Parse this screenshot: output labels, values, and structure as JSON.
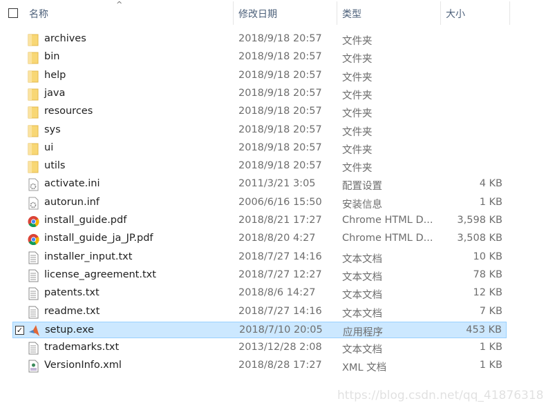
{
  "columns": {
    "name": "名称",
    "modified": "修改日期",
    "type": "类型",
    "size": "大小"
  },
  "files": [
    {
      "name": "archives",
      "modified": "2018/9/18 20:57",
      "type": "文件夹",
      "size": "",
      "icon": "folder"
    },
    {
      "name": "bin",
      "modified": "2018/9/18 20:57",
      "type": "文件夹",
      "size": "",
      "icon": "folder"
    },
    {
      "name": "help",
      "modified": "2018/9/18 20:57",
      "type": "文件夹",
      "size": "",
      "icon": "folder"
    },
    {
      "name": "java",
      "modified": "2018/9/18 20:57",
      "type": "文件夹",
      "size": "",
      "icon": "folder"
    },
    {
      "name": "resources",
      "modified": "2018/9/18 20:57",
      "type": "文件夹",
      "size": "",
      "icon": "folder"
    },
    {
      "name": "sys",
      "modified": "2018/9/18 20:57",
      "type": "文件夹",
      "size": "",
      "icon": "folder"
    },
    {
      "name": "ui",
      "modified": "2018/9/18 20:57",
      "type": "文件夹",
      "size": "",
      "icon": "folder"
    },
    {
      "name": "utils",
      "modified": "2018/9/18 20:57",
      "type": "文件夹",
      "size": "",
      "icon": "folder"
    },
    {
      "name": "activate.ini",
      "modified": "2011/3/21 3:05",
      "type": "配置设置",
      "size": "4 KB",
      "icon": "settings-file"
    },
    {
      "name": "autorun.inf",
      "modified": "2006/6/16 15:50",
      "type": "安装信息",
      "size": "1 KB",
      "icon": "settings-file"
    },
    {
      "name": "install_guide.pdf",
      "modified": "2018/8/21 17:27",
      "type": "Chrome HTML D...",
      "size": "3,598 KB",
      "icon": "chrome"
    },
    {
      "name": "install_guide_ja_JP.pdf",
      "modified": "2018/8/20 4:27",
      "type": "Chrome HTML D...",
      "size": "3,508 KB",
      "icon": "chrome"
    },
    {
      "name": "installer_input.txt",
      "modified": "2018/7/27 14:16",
      "type": "文本文档",
      "size": "10 KB",
      "icon": "text-file"
    },
    {
      "name": "license_agreement.txt",
      "modified": "2018/7/27 12:27",
      "type": "文本文档",
      "size": "78 KB",
      "icon": "text-file"
    },
    {
      "name": "patents.txt",
      "modified": "2018/8/6 14:27",
      "type": "文本文档",
      "size": "12 KB",
      "icon": "text-file"
    },
    {
      "name": "readme.txt",
      "modified": "2018/7/27 14:16",
      "type": "文本文档",
      "size": "7 KB",
      "icon": "text-file"
    },
    {
      "name": "setup.exe",
      "modified": "2018/7/10 20:05",
      "type": "应用程序",
      "size": "453 KB",
      "icon": "matlab",
      "selected": true
    },
    {
      "name": "trademarks.txt",
      "modified": "2013/12/28 2:08",
      "type": "文本文档",
      "size": "1 KB",
      "icon": "text-file"
    },
    {
      "name": "VersionInfo.xml",
      "modified": "2018/8/28 17:27",
      "type": "XML 文档",
      "size": "1 KB",
      "icon": "xml-file"
    }
  ],
  "watermark": "https://blog.csdn.net/qq_41876318",
  "colors": {
    "selection": "#cce8ff",
    "folder": "#f8d775"
  }
}
